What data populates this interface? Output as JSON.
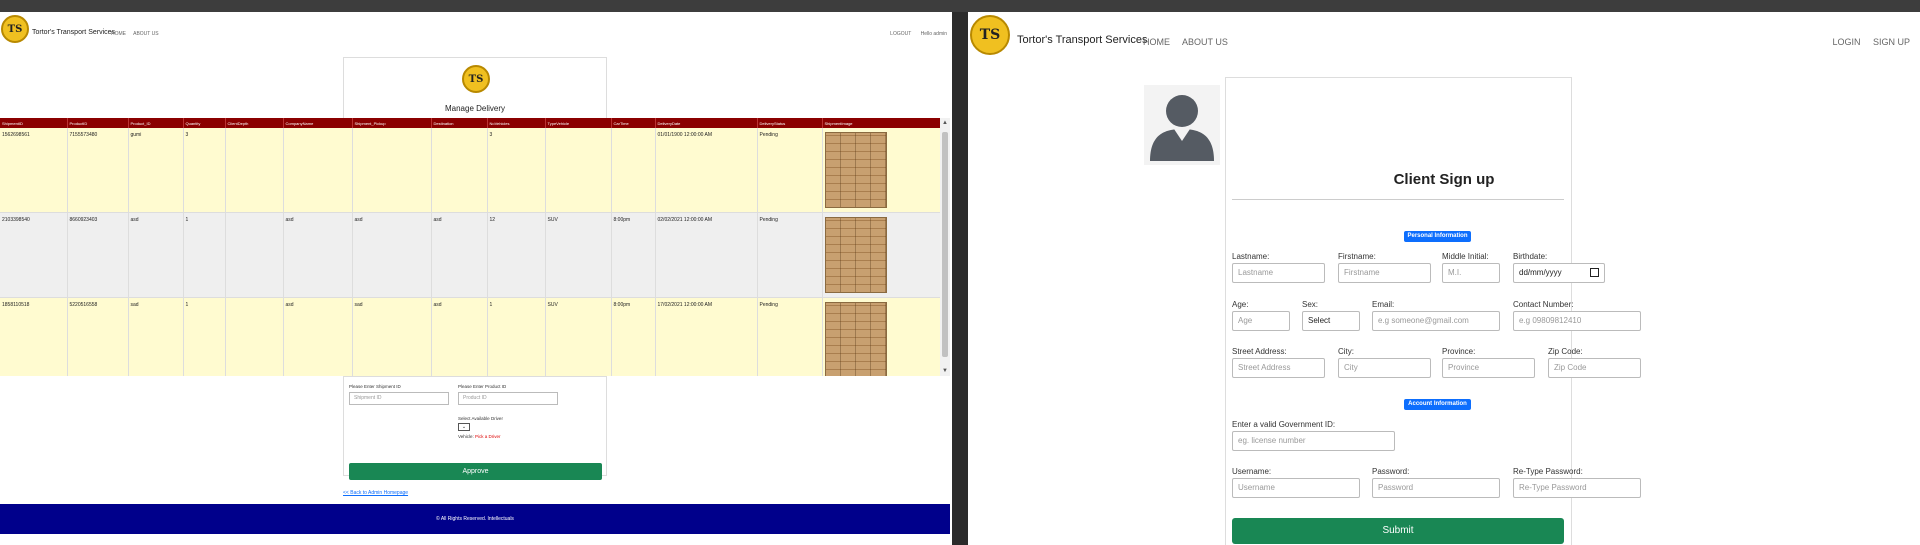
{
  "left": {
    "brand": "Tortor's Transport Services",
    "nav": [
      "HOME",
      "ABOUT US"
    ],
    "right_nav": [
      "LOGOUT",
      "Hello admin"
    ],
    "title": "Manage Delivery",
    "columns": [
      "ShipmentID",
      "ProductID",
      "Product_ID",
      "Quantity",
      "ClientDepth",
      "CompanyName",
      "Shipment_Pickup",
      "Destination",
      "NoVehicles",
      "TypeVehicle",
      "CarTime",
      "DeliveryDate",
      "DeliveryStatus",
      "ShipmentImage"
    ],
    "rows": [
      [
        "1562698561",
        "7155573480",
        "gumi",
        "3",
        "",
        "",
        "",
        "",
        "3",
        "",
        "",
        "01/01/1900 12:00:00 AM",
        "Pending"
      ],
      [
        "2103398540",
        "8660923403",
        "asd",
        "1",
        "",
        "asd",
        "asd",
        "asd",
        "12",
        "SUV",
        "8:00pm",
        "02/02/2021 12:00:00 AM",
        "Pending"
      ],
      [
        "1858110518",
        "5220516558",
        "sad",
        "1",
        "",
        "asd",
        "sad",
        "asd",
        "1",
        "SUV",
        "8:00pm",
        "17/02/2021 12:00:00 AM",
        "Pending"
      ]
    ],
    "form": {
      "shipment_label": "Please Enter Shipment ID",
      "shipment_placeholder": "Shipment ID",
      "product_label": "Please Enter Product ID",
      "product_placeholder": "Product ID",
      "driver_label": "Select Available Driver",
      "vehicle_label": "Vehicle:",
      "vehicle_value": "Pick a Driver",
      "approve": "Approve"
    },
    "back_link": "<< Back to Admin Homepage",
    "footer": "© All Rights Reserved. Intellectuals"
  },
  "right": {
    "brand": "Tortor's Transport Services",
    "nav": [
      "HOME",
      "ABOUT US"
    ],
    "right_nav": [
      "LOGIN",
      "SIGN UP"
    ],
    "title": "Client Sign up",
    "personal_badge": "Personal Information",
    "account_badge": "Account Information",
    "fields": {
      "lastname": {
        "label": "Lastname:",
        "placeholder": "Lastname"
      },
      "firstname": {
        "label": "Firstname:",
        "placeholder": "Firstname"
      },
      "middle": {
        "label": "Middle Initial:",
        "placeholder": "M.I."
      },
      "birthdate": {
        "label": "Birthdate:",
        "placeholder": "dd/mm/yyyy"
      },
      "age": {
        "label": "Age:",
        "placeholder": "Age"
      },
      "sex": {
        "label": "Sex:",
        "value": "Select"
      },
      "email": {
        "label": "Email:",
        "placeholder": "e.g someone@gmail.com"
      },
      "contact": {
        "label": "Contact Number:",
        "placeholder": "e.g 09809812410"
      },
      "street": {
        "label": "Street Address:",
        "placeholder": "Street Address"
      },
      "city": {
        "label": "City:",
        "placeholder": "City"
      },
      "province": {
        "label": "Province:",
        "placeholder": "Province"
      },
      "zip": {
        "label": "Zip Code:",
        "placeholder": "Zip Code"
      },
      "govid": {
        "label": "Enter a valid Government ID:",
        "placeholder": "eg. license number"
      },
      "username": {
        "label": "Username:",
        "placeholder": "Username"
      },
      "password": {
        "label": "Password:",
        "placeholder": "Password"
      },
      "repassword": {
        "label": "Re-Type Password:",
        "placeholder": "Re-Type Password"
      }
    },
    "submit": "Submit"
  },
  "colors": {
    "table_header": "#8b0000",
    "row_yellow": "#fffbd0",
    "row_gray": "#efefef",
    "approve": "#198754",
    "footer": "#00008b",
    "badge": "#0d6efd"
  },
  "icons": {
    "logo": "tts-logo",
    "avatar": "user-avatar-icon",
    "calendar": "calendar-icon"
  }
}
